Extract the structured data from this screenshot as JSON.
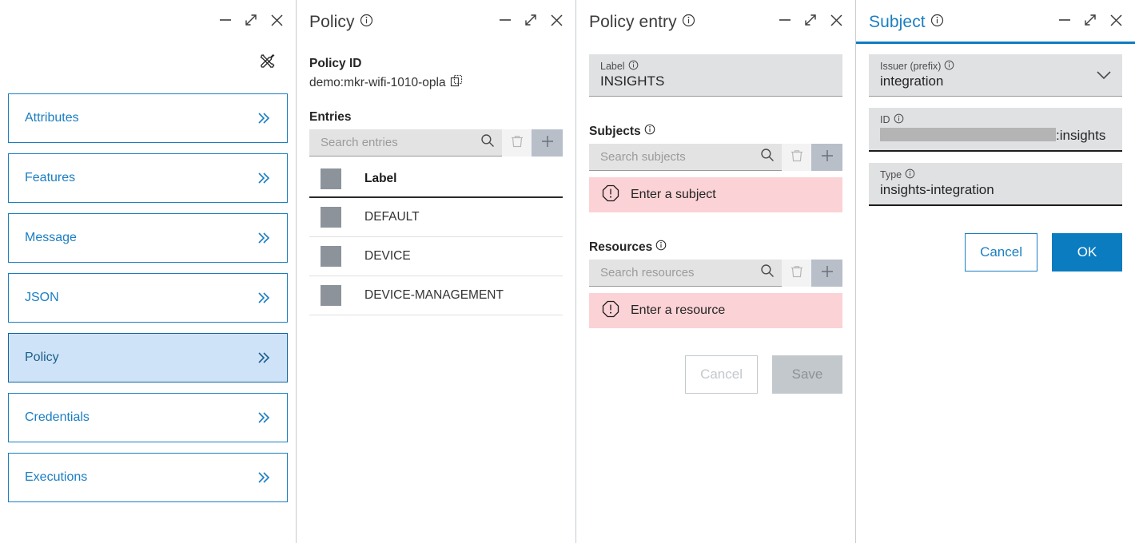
{
  "colors": {
    "accent_blue": "#1a7ec2",
    "filled_blue": "#0b7cc0",
    "selected_nav_bg": "#cfe3f8",
    "field_grey": "#e0e1e3",
    "alert_pink": "#fbd2d5",
    "add_button_grey": "#b8bfc8"
  },
  "nav_panel": {
    "tools_icon": "tools-icon",
    "window_controls": [
      "minimize-icon",
      "expand-icon",
      "close-icon"
    ],
    "items": [
      {
        "label": "Attributes",
        "selected": false
      },
      {
        "label": "Features",
        "selected": false
      },
      {
        "label": "Message",
        "selected": false
      },
      {
        "label": "JSON",
        "selected": false
      },
      {
        "label": "Policy",
        "selected": true
      },
      {
        "label": "Credentials",
        "selected": false
      },
      {
        "label": "Executions",
        "selected": false
      }
    ]
  },
  "policy_panel": {
    "title": "Policy",
    "info_icon": "info-icon",
    "policy_id_label": "Policy ID",
    "policy_id_value": "demo:mkr-wifi-1010-opla",
    "copy_icon": "copy-icon",
    "entries_label": "Entries",
    "search": {
      "placeholder": "Search entries",
      "value": "",
      "search_icon": "search-icon",
      "delete_icon": "trash-icon",
      "add_icon": "plus-icon"
    },
    "table": {
      "columns": [
        "Label"
      ],
      "rows": [
        {
          "label": "DEFAULT"
        },
        {
          "label": "DEVICE"
        },
        {
          "label": "DEVICE-MANAGEMENT"
        }
      ]
    }
  },
  "entry_panel": {
    "title": "Policy entry",
    "info_icon": "info-icon",
    "label_field": {
      "label": "Label",
      "value": "INSIGHTS"
    },
    "subjects": {
      "heading": "Subjects",
      "search_placeholder": "Search subjects",
      "search_value": "",
      "error": "Enter a subject",
      "error_icon": "error-octagon-icon"
    },
    "resources": {
      "heading": "Resources",
      "search_placeholder": "Search resources",
      "search_value": "",
      "error": "Enter a resource",
      "error_icon": "error-octagon-icon"
    },
    "buttons": {
      "cancel": "Cancel",
      "save": "Save",
      "cancel_disabled": true,
      "save_disabled": true
    }
  },
  "subject_panel": {
    "title": "Subject",
    "info_icon": "info-icon",
    "issuer": {
      "label": "Issuer (prefix)",
      "value": "integration",
      "chevron": "chevron-down-icon"
    },
    "id": {
      "label": "ID",
      "redacted": true,
      "suffix": ":insights"
    },
    "type": {
      "label": "Type",
      "value": "insights-integration"
    },
    "buttons": {
      "cancel": "Cancel",
      "ok": "OK"
    }
  }
}
